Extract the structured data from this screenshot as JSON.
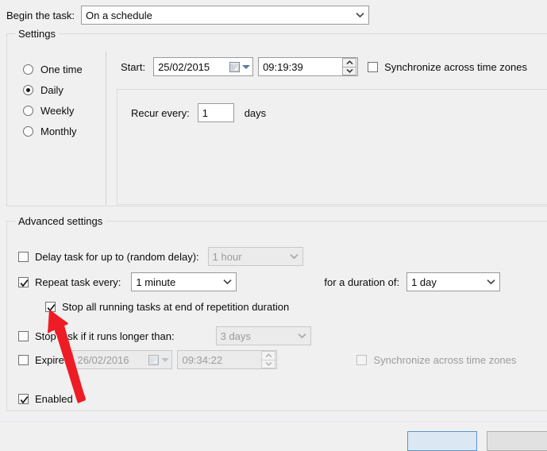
{
  "dialog": {
    "begin_task_label": "Begin the task:",
    "begin_task_value": "On a schedule"
  },
  "settings_group": {
    "legend": "Settings",
    "schedule_options": [
      {
        "label": "One time",
        "selected": false
      },
      {
        "label": "Daily",
        "selected": true
      },
      {
        "label": "Weekly",
        "selected": false
      },
      {
        "label": "Monthly",
        "selected": false
      }
    ],
    "start_label": "Start:",
    "start_date": "25/02/2015",
    "start_time": "09:19:39",
    "sync_timezones_label": "Synchronize across time zones",
    "sync_timezones_checked": false,
    "recur_label": "Recur every:",
    "recur_value": "1",
    "recur_unit": "days"
  },
  "advanced_group": {
    "legend": "Advanced settings",
    "delay_task": {
      "label": "Delay task for up to (random delay):",
      "checked": false,
      "value": "1 hour",
      "enabled": false
    },
    "repeat_task": {
      "label": "Repeat task every:",
      "checked": true,
      "value": "1 minute",
      "enabled": true,
      "duration_label": "for a duration of:",
      "duration_value": "1 day"
    },
    "stop_at_end": {
      "label": "Stop all running tasks at end of repetition duration",
      "checked": true,
      "enabled": true
    },
    "stop_if_longer": {
      "label": "Stop task if it runs longer than:",
      "checked": false,
      "value": "3 days",
      "enabled": false
    },
    "expire": {
      "label": "Expire:",
      "checked": false,
      "date": "26/02/2016",
      "time": "09:34:22",
      "sync_timezones_label": "Synchronize across time zones",
      "sync_timezones_checked": false,
      "enabled": false
    },
    "enabled_checkbox": {
      "label": "Enabled",
      "checked": true
    }
  },
  "icons": {
    "dropdown": "chevron-down-icon",
    "calendar": "calendar-icon",
    "spinner_up": "spinner-up-icon",
    "spinner_down": "spinner-down-icon",
    "check": "check-mark-icon",
    "annotation": "red-arrow-annotation-icon"
  },
  "colors": {
    "dialog_background": "#f0f0f0",
    "field_background": "#ffffff",
    "disabled_background": "#ebebeb",
    "disabled_text": "#9b9b9b",
    "group_border": "#dcdcdc",
    "annotation_red": "#ee1c25",
    "focus_blue": "#5a94cf"
  }
}
